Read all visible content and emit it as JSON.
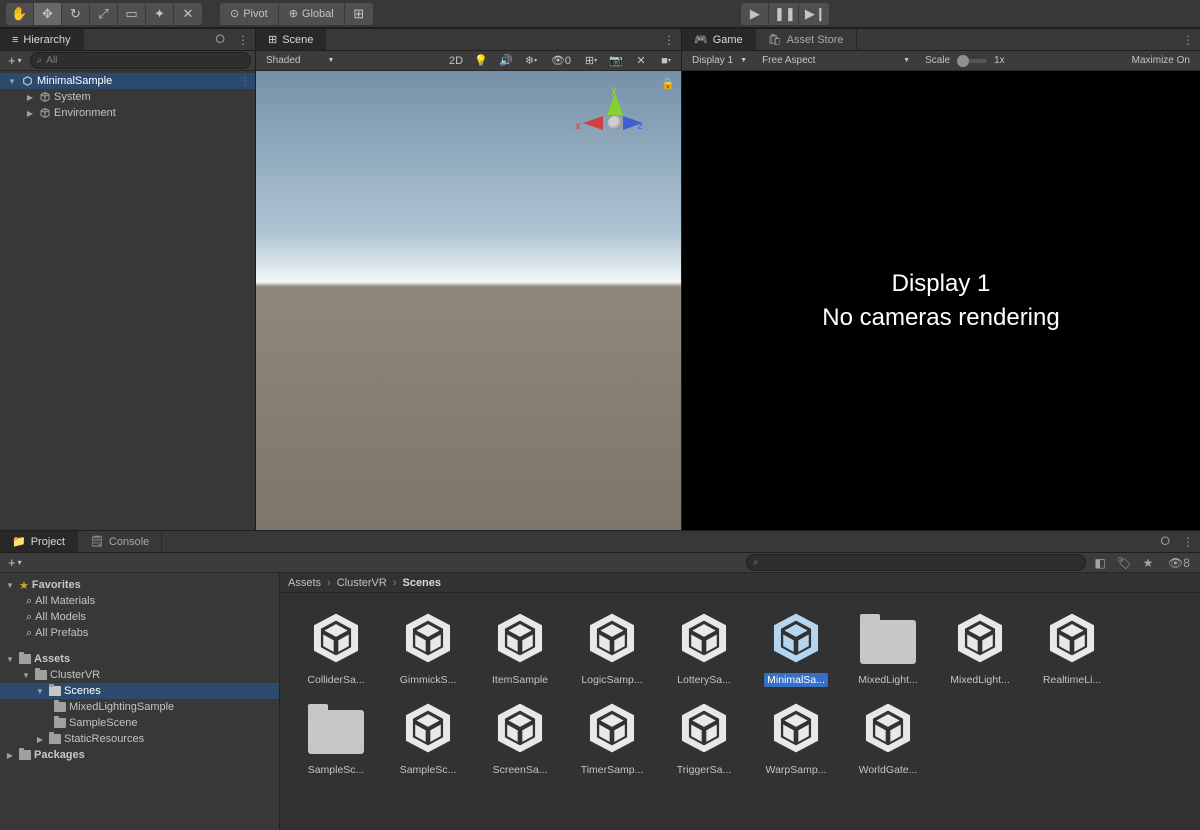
{
  "toolbar": {
    "pivot": "Pivot",
    "global": "Global"
  },
  "hierarchy": {
    "title": "Hierarchy",
    "search_placeholder": "All",
    "scene": "MinimalSample",
    "children": [
      "System",
      "Environment"
    ]
  },
  "scene_panel": {
    "tab": "Scene",
    "shade_mode": "Shaded",
    "toggle_2d": "2D",
    "gizmo_count": "0"
  },
  "game_panel": {
    "tab_game": "Game",
    "tab_asset_store": "Asset Store",
    "display": "Display 1",
    "aspect": "Free Aspect",
    "scale_label": "Scale",
    "scale_value": "1x",
    "maximize": "Maximize On",
    "msg_line1": "Display 1",
    "msg_line2": "No cameras rendering"
  },
  "bottom": {
    "tab_project": "Project",
    "tab_console": "Console",
    "hidden_count": "8",
    "favorites": {
      "label": "Favorites",
      "items": [
        "All Materials",
        "All Models",
        "All Prefabs"
      ]
    },
    "assets_root": "Assets",
    "tree": {
      "clustervr": "ClusterVR",
      "scenes": "Scenes",
      "mixed": "MixedLightingSample",
      "samplescene": "SampleScene",
      "static": "StaticResources",
      "packages": "Packages"
    },
    "breadcrumb": [
      "Assets",
      "ClusterVR",
      "Scenes"
    ],
    "grid": [
      {
        "name": "ColliderSa...",
        "type": "unity"
      },
      {
        "name": "GimmickS...",
        "type": "unity"
      },
      {
        "name": "ItemSample",
        "type": "unity"
      },
      {
        "name": "LogicSamp...",
        "type": "unity"
      },
      {
        "name": "LotterySa...",
        "type": "unity"
      },
      {
        "name": "MinimalSa...",
        "type": "unity",
        "selected": true
      },
      {
        "name": "MixedLight...",
        "type": "folder"
      },
      {
        "name": "MixedLight...",
        "type": "unity"
      },
      {
        "name": "RealtimeLi...",
        "type": "unity"
      },
      {
        "name": "SampleSc...",
        "type": "folder"
      },
      {
        "name": "SampleSc...",
        "type": "unity"
      },
      {
        "name": "ScreenSa...",
        "type": "unity"
      },
      {
        "name": "TimerSamp...",
        "type": "unity"
      },
      {
        "name": "TriggerSa...",
        "type": "unity"
      },
      {
        "name": "WarpSamp...",
        "type": "unity"
      },
      {
        "name": "WorldGate...",
        "type": "unity"
      }
    ]
  }
}
